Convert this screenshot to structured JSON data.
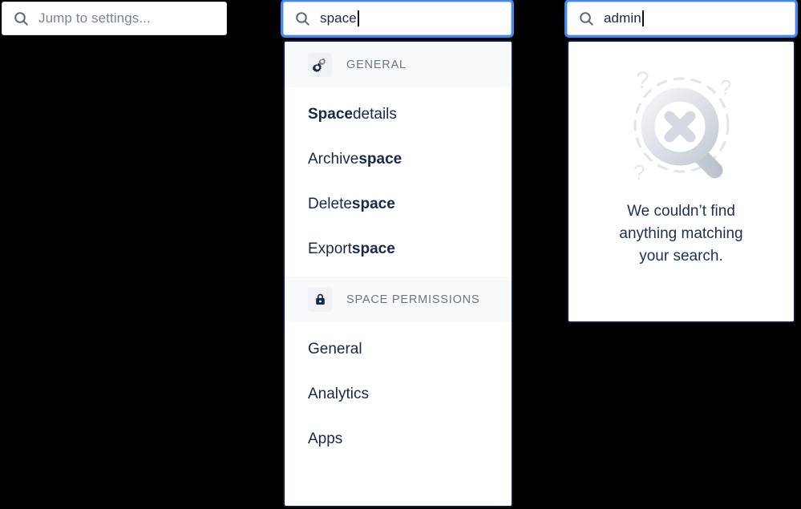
{
  "fields": [
    {
      "id": "jump",
      "icon": "search-icon",
      "placeholder": "Jump to settings...",
      "value": "",
      "focused": false,
      "has_caret": false
    },
    {
      "id": "space",
      "icon": "search-icon",
      "placeholder": "Jump to settings...",
      "value": "space",
      "focused": true,
      "has_caret": true
    },
    {
      "id": "admin",
      "icon": "search-icon",
      "placeholder": "Jump to settings...",
      "value": "admin",
      "focused": true,
      "has_caret": true
    }
  ],
  "results": {
    "query": "space",
    "sections": [
      {
        "title": "GENERAL",
        "icon": "cogs-icon",
        "items": [
          {
            "prefix": "",
            "match": "Space",
            "suffix": " details"
          },
          {
            "prefix": "Archive ",
            "match": "space",
            "suffix": ""
          },
          {
            "prefix": "Delete ",
            "match": "space",
            "suffix": ""
          },
          {
            "prefix": "Export ",
            "match": "space",
            "suffix": ""
          }
        ]
      },
      {
        "title": "SPACE PERMISSIONS",
        "icon": "lock-icon",
        "items": [
          {
            "prefix": "General",
            "match": "",
            "suffix": ""
          },
          {
            "prefix": "Analytics",
            "match": "",
            "suffix": ""
          },
          {
            "prefix": "Apps",
            "match": "",
            "suffix": ""
          }
        ]
      }
    ]
  },
  "empty_state": {
    "query": "admin",
    "illustration": "magnifier-no-results-icon",
    "message": "We couldn’t find anything matching your search."
  },
  "colors": {
    "focus_ring": "#3f8bf5",
    "panel_border": "#0c1b3a",
    "text_primary": "#16284c",
    "text_muted": "#6b7689",
    "placeholder": "#77849b",
    "section_band": "#f8f9fb",
    "illustration_grey": "#d7dbe2"
  }
}
